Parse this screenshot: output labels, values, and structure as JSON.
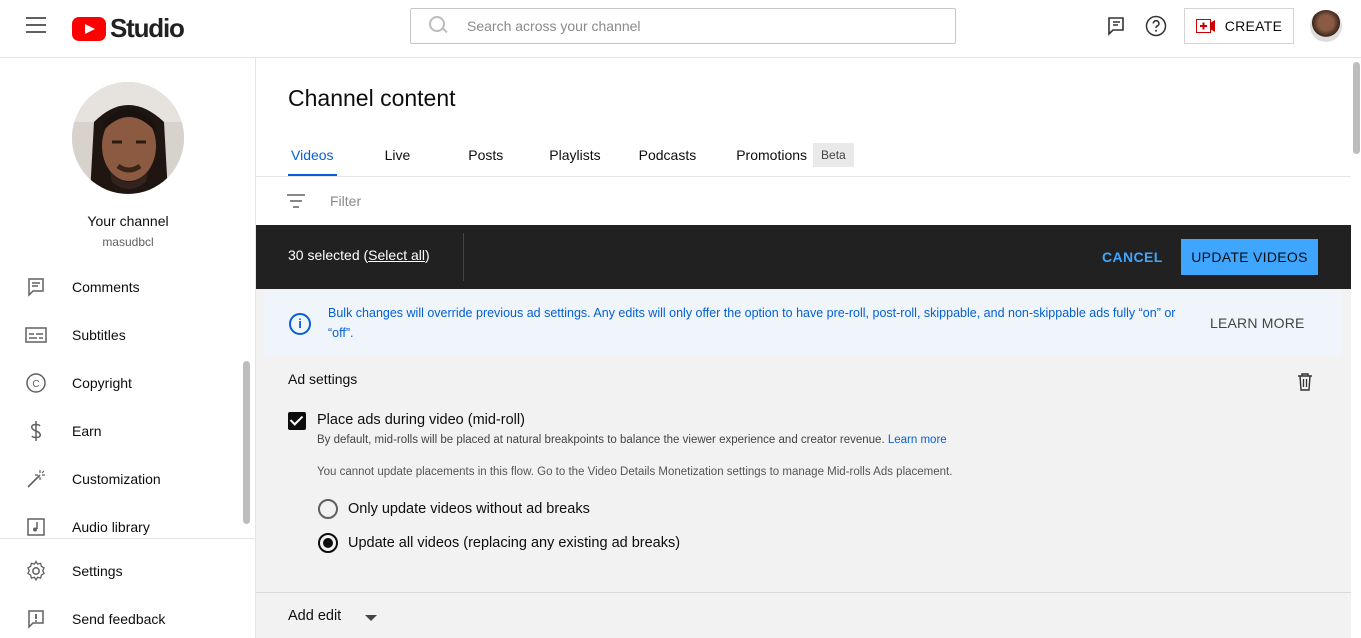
{
  "header": {
    "logo_text": "Studio",
    "search_placeholder": "Search across your channel",
    "create_label": "CREATE"
  },
  "sidebar": {
    "channel_title": "Your channel",
    "channel_handle": "masudbcl",
    "items": [
      {
        "label": "Comments",
        "icon": "comments-icon"
      },
      {
        "label": "Subtitles",
        "icon": "subtitles-icon"
      },
      {
        "label": "Copyright",
        "icon": "copyright-icon"
      },
      {
        "label": "Earn",
        "icon": "earn-icon"
      },
      {
        "label": "Customization",
        "icon": "customization-icon"
      },
      {
        "label": "Audio library",
        "icon": "audio-library-icon"
      }
    ],
    "bottom_items": [
      {
        "label": "Settings",
        "icon": "settings-icon"
      },
      {
        "label": "Send feedback",
        "icon": "feedback-icon"
      }
    ]
  },
  "main": {
    "title": "Channel content",
    "tabs": [
      {
        "label": "Videos",
        "active": true
      },
      {
        "label": "Live"
      },
      {
        "label": "Posts"
      },
      {
        "label": "Playlists"
      },
      {
        "label": "Podcasts"
      },
      {
        "label": "Promotions"
      }
    ],
    "beta_badge": "Beta",
    "filter_label": "Filter",
    "selection": {
      "count_text": "30 selected (",
      "select_all": "Select all",
      "close_paren": ")",
      "cancel_label": "CANCEL",
      "update_label": "UPDATE VIDEOS"
    },
    "info": {
      "text": "Bulk changes will override previous ad settings. Any edits will only offer the option to have pre-roll, post-roll, skippable, and non-skippable ads fully “on” or “off”.",
      "learn_more": "LEARN MORE"
    },
    "ad_settings": {
      "title": "Ad settings",
      "checkbox_label": "Place ads during video (mid-roll)",
      "checkbox_checked": true,
      "description": "By default, mid-rolls will be placed at natural breakpoints to balance the viewer experience and creator revenue.",
      "learn_more_link": "Learn more",
      "note": "You cannot update placements in this flow. Go to the Video Details Monetization settings to manage Mid-rolls Ads placement.",
      "radio_options": [
        {
          "label": "Only update videos without ad breaks",
          "selected": false
        },
        {
          "label": "Update all videos (replacing any existing ad breaks)",
          "selected": true
        }
      ]
    },
    "add_edit_label": "Add edit"
  },
  "colors": {
    "accent_blue": "#065fd4",
    "button_blue": "#3ea6ff",
    "youtube_red": "#ff0000",
    "selection_bar": "#212121"
  }
}
